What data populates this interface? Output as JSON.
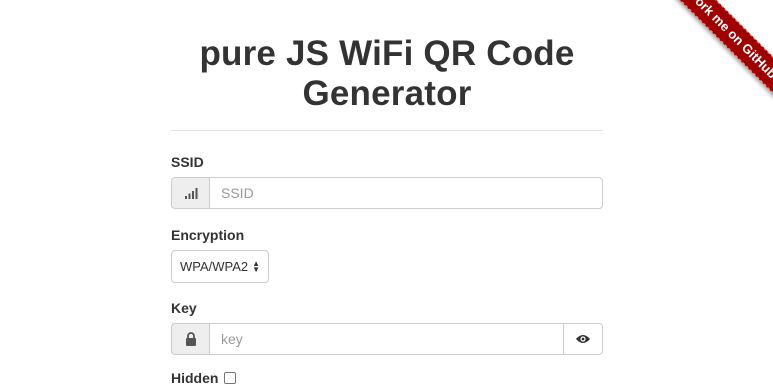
{
  "ribbon": {
    "label": "Fork me on GitHub"
  },
  "header": {
    "title": "pure JS WiFi QR Code Generator"
  },
  "form": {
    "ssid": {
      "label": "SSID",
      "placeholder": "SSID",
      "icon": "signal-icon"
    },
    "encryption": {
      "label": "Encryption",
      "selected": "WPA/WPA2"
    },
    "key": {
      "label": "Key",
      "placeholder": "key",
      "icon": "lock-icon",
      "toggle_icon": "eye-icon"
    },
    "hidden": {
      "label": "Hidden",
      "checked": false
    }
  }
}
